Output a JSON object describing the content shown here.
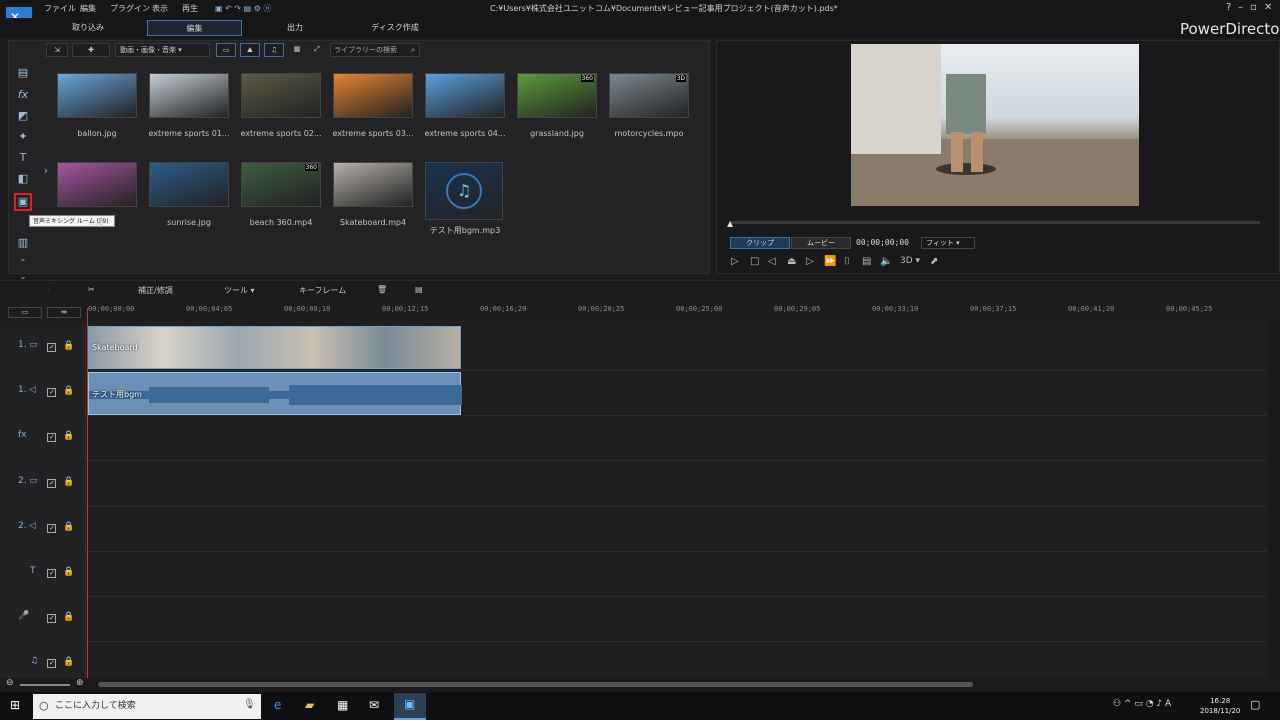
{
  "window": {
    "path": "C:¥Users¥株式会社ユニットコム¥Documents¥レビュー記事用プロジェクト(音声カット).pds*",
    "brand": "PowerDirector"
  },
  "menu": [
    "ファイル",
    "編集",
    "プラグイン",
    "表示",
    "再生"
  ],
  "tabs": [
    "取り込み",
    "編集",
    "出力",
    "ディスク作成"
  ],
  "library": {
    "filter": "動画・画像・音楽",
    "search_placeholder": "ライブラリーの検索",
    "items": [
      {
        "label": "ballon.jpg",
        "color": "#6aa6d8"
      },
      {
        "label": "extreme sports 01...",
        "color": "#c4ced6"
      },
      {
        "label": "extreme sports 02...",
        "color": "#5b5a45"
      },
      {
        "label": "extreme sports 03...",
        "color": "#e58433"
      },
      {
        "label": "extreme sports 04...",
        "color": "#5aa0dc"
      },
      {
        "label": "grassland.jpg",
        "color": "#5d9b3d",
        "badge": "360"
      },
      {
        "label": "motorcycles.mpo",
        "color": "#7c8890",
        "badge": "3D"
      },
      {
        "label": "...g",
        "color": "#a5579f"
      },
      {
        "label": "sunrise.jpg",
        "color": "#2f5c8a"
      },
      {
        "label": "beach 360.mp4",
        "color": "#3e5e3f",
        "badge": "360"
      },
      {
        "label": "Skateboard.mp4",
        "color": "#b6b1a8"
      },
      {
        "label": "テスト用bgm.mp3",
        "color": "#1a3450"
      }
    ]
  },
  "tooltip": "音声ミキシング ルーム (F9)",
  "preview": {
    "clip_btn": "クリップ",
    "movie_btn": "ムービー",
    "timecode": "00;00;00;00",
    "fit": "フィット",
    "three_d": "3D"
  },
  "timeline_tools": {
    "fix": "補正/修調",
    "tools": "ツール",
    "keyframe": "キーフレーム"
  },
  "ruler": [
    "00;00;00;00",
    "00;00;04;05",
    "00;00;08;10",
    "00;00;12;15",
    "00;00;16;20",
    "00;00;20;25",
    "00;00;25;00",
    "00;00;29;05",
    "00;00;33;10",
    "00;00;37;15",
    "00;00;41;20",
    "00;00;45;25"
  ],
  "tracks": [
    {
      "name": "1."
    },
    {
      "name": "1."
    },
    {
      "name": "fx"
    },
    {
      "name": "2."
    },
    {
      "name": "2."
    },
    {
      "name": "T"
    },
    {
      "name": "🎤"
    },
    {
      "name": "♫"
    }
  ],
  "clips": {
    "video": "Skateboard",
    "audio": "テスト用bgm"
  },
  "taskbar": {
    "search": "ここに入力して検索",
    "time": "16:28",
    "date": "2018/11/20"
  }
}
